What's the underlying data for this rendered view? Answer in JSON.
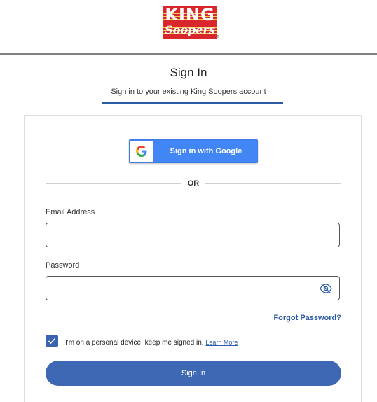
{
  "brand": {
    "logo_line1": "KING",
    "logo_line2": "Soopers",
    "logo_mark": "®",
    "colors": {
      "red": "#d9262c",
      "yellow": "#f2d04a",
      "accent_blue": "#2c5ca6"
    }
  },
  "header": {
    "title": "Sign In",
    "subtitle": "Sign in to your existing King Soopers account"
  },
  "google": {
    "label": "Sign in with Google",
    "icon": "google-g-icon"
  },
  "separator": {
    "label": "OR"
  },
  "email": {
    "label": "Email Address",
    "value": "",
    "placeholder": ""
  },
  "password": {
    "label": "Password",
    "value": "",
    "placeholder": "",
    "toggle_icon": "eye-slash-icon"
  },
  "forgot": {
    "label": "Forgot Password?"
  },
  "remember": {
    "checked": true,
    "label": "I'm on a personal device, keep me signed in.",
    "learn_more": "Learn More"
  },
  "submit": {
    "label": "Sign In"
  }
}
